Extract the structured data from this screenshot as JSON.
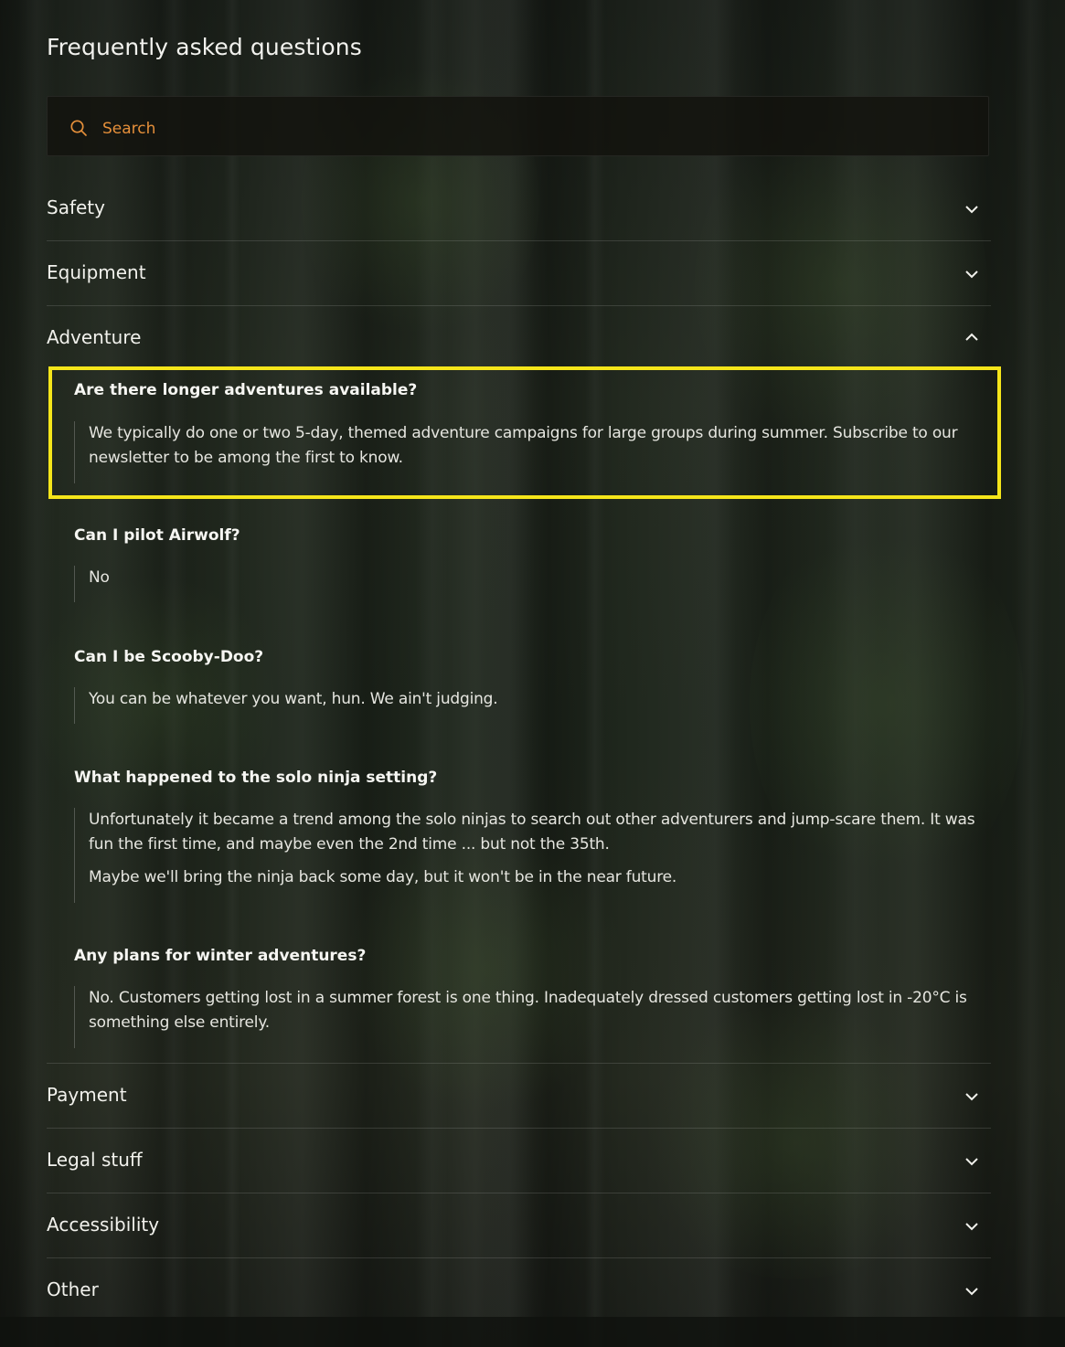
{
  "page": {
    "title": "Frequently asked questions"
  },
  "search": {
    "placeholder": "Search",
    "icon": "search-icon"
  },
  "categories": [
    {
      "label": "Safety",
      "expanded": false,
      "icon": "chevron-down-icon"
    },
    {
      "label": "Equipment",
      "expanded": false,
      "icon": "chevron-down-icon"
    },
    {
      "label": "Adventure",
      "expanded": true,
      "icon": "chevron-up-icon"
    },
    {
      "label": "Payment",
      "expanded": false,
      "icon": "chevron-down-icon"
    },
    {
      "label": "Legal stuff",
      "expanded": false,
      "icon": "chevron-down-icon"
    },
    {
      "label": "Accessibility",
      "expanded": false,
      "icon": "chevron-down-icon"
    },
    {
      "label": "Other",
      "expanded": false,
      "icon": "chevron-down-icon"
    }
  ],
  "adventure_faqs": [
    {
      "question": "Are there longer adventures available?",
      "answer": [
        "We typically do one or two 5-day, themed adventure campaigns for large groups during summer.  Subscribe to our newsletter to be among the first to know."
      ],
      "highlighted": true
    },
    {
      "question": "Can I pilot Airwolf?",
      "answer": [
        "No"
      ],
      "highlighted": false
    },
    {
      "question": "Can I be Scooby-Doo?",
      "answer": [
        "You can be whatever you want, hun. We ain't judging."
      ],
      "highlighted": false
    },
    {
      "question": "What happened to the solo ninja setting?",
      "answer": [
        "Unfortunately it became a trend among the solo ninjas to search out other adventurers and jump-scare them. It was fun the first time, and maybe even the 2nd time ... but not the 35th.",
        "Maybe we'll bring the ninja back some day, but it won't be in the near future."
      ],
      "highlighted": false
    },
    {
      "question": "Any plans for winter adventures?",
      "answer": [
        "No. Customers getting lost in a summer forest is one thing. Inadequately dressed customers getting lost in -20°C is something else entirely."
      ],
      "highlighted": false
    }
  ],
  "colors": {
    "accent": "#e58f3a",
    "highlight": "#f5e51a",
    "text": "#f1f1ec"
  }
}
